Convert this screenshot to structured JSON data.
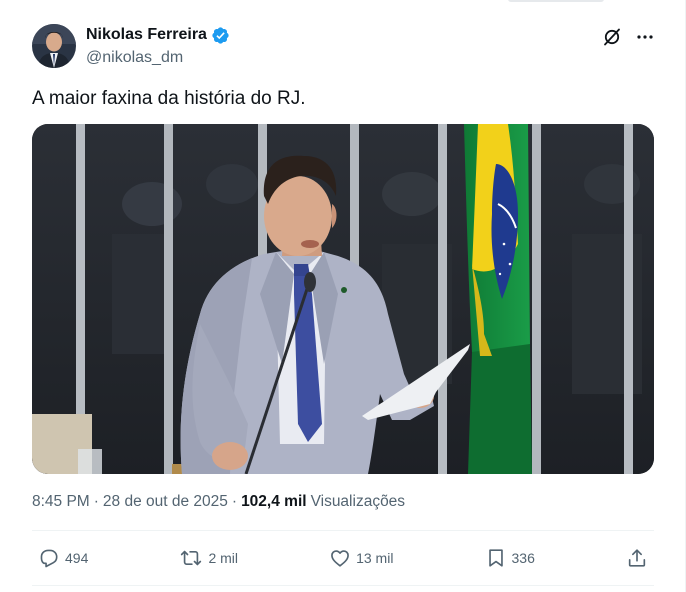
{
  "author": {
    "display_name": "Nikolas Ferreira",
    "handle": "@nikolas_dm",
    "verified": true
  },
  "tweet": {
    "text": "A maior faxina da história do RJ."
  },
  "meta": {
    "time": "8:45 PM",
    "date": "28 de out de 2025",
    "views_count": "102,4 mil",
    "views_label": "Visualizações",
    "separator": "·"
  },
  "actions": {
    "replies": "494",
    "reposts": "2 mil",
    "likes": "13 mil",
    "bookmarks": "336"
  },
  "icons": {
    "header": [
      "grok-icon",
      "more-options-icon"
    ],
    "actions": [
      "reply-icon",
      "repost-icon",
      "like-icon",
      "bookmark-icon",
      "share-icon"
    ]
  },
  "colors": {
    "verified_blue": "#1d9bf0",
    "text_primary": "#0f1419",
    "text_secondary": "#536471",
    "divider": "#eff3f4"
  }
}
